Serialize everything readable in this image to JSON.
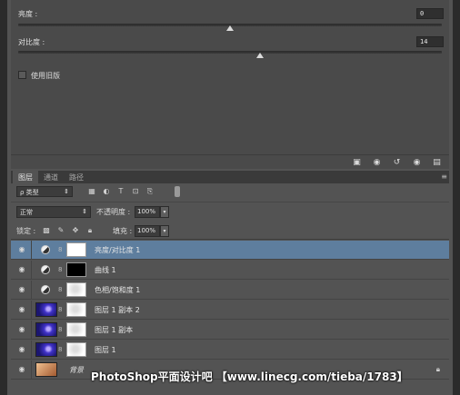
{
  "properties": {
    "brightness_label": "亮度 :",
    "brightness_value": "0",
    "brightness_level": 0.5,
    "contrast_label": "对比度 :",
    "contrast_value": "14",
    "contrast_level": 0.57,
    "legacy_label": "使用旧版"
  },
  "tabs": [
    {
      "label": "图层"
    },
    {
      "label": "通道"
    },
    {
      "label": "路径"
    }
  ],
  "filter": {
    "kind_label": "ρ 类型"
  },
  "blend": {
    "mode": "正常",
    "opacity_label": "不透明度 :",
    "opacity_value": "100%"
  },
  "lock": {
    "label": "锁定 :",
    "fill_label": "填充 :",
    "fill_value": "100%"
  },
  "layers": [
    {
      "name": "亮度/对比度 1",
      "type": "adjustment",
      "mask": "white",
      "selected": true
    },
    {
      "name": "曲线 1",
      "type": "adjustment",
      "mask": "black",
      "selected": false
    },
    {
      "name": "色相/饱和度 1",
      "type": "adjustment",
      "mask": "light",
      "selected": false
    },
    {
      "name": "图层 1 副本 2",
      "type": "image",
      "mask": "light",
      "selected": false
    },
    {
      "name": "图层 1 副本",
      "type": "image",
      "mask": "light",
      "selected": false
    },
    {
      "name": "图层 1",
      "type": "image",
      "mask": "light",
      "selected": false
    },
    {
      "name": "背景",
      "type": "background",
      "mask": "",
      "selected": false
    }
  ],
  "watermark": "PhotoShop平面设计吧 【www.linecg.com/tieba/1783】",
  "colors": {
    "panel": "#535353",
    "selected_row": "#5e7e9e"
  }
}
